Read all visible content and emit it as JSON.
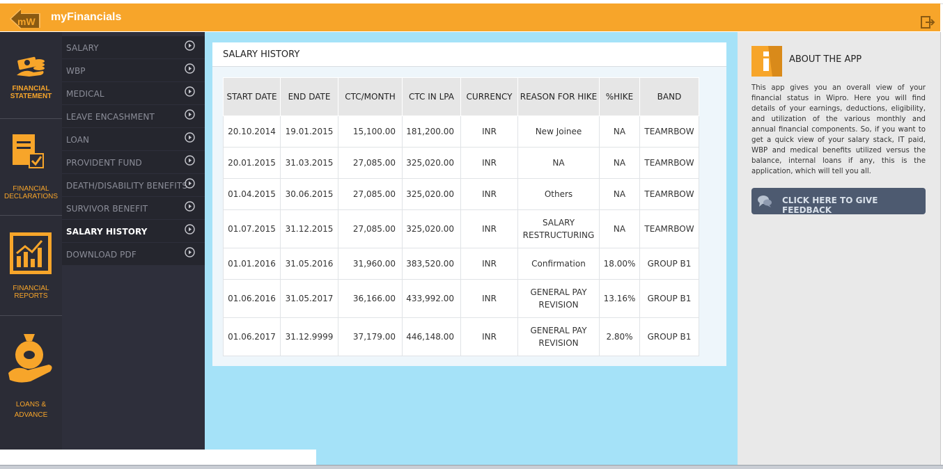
{
  "app": {
    "logo_text": "mW",
    "title": "myFinancials"
  },
  "leftnav": [
    {
      "label": "FINANCIAL STATEMENT",
      "icon": "money-icon"
    },
    {
      "label": "FINANCIAL DECLARATIONS",
      "icon": "declaration-doc-icon"
    },
    {
      "label": "FINANCIAL REPORTS",
      "icon": "report-chart-icon"
    },
    {
      "label": "LOANS & ADVANCE",
      "icon": "money-bag-hand-icon"
    }
  ],
  "submenu": [
    {
      "label": "SALARY"
    },
    {
      "label": "WBP"
    },
    {
      "label": "MEDICAL"
    },
    {
      "label": "LEAVE ENCASHMENT"
    },
    {
      "label": "LOAN"
    },
    {
      "label": "PROVIDENT FUND"
    },
    {
      "label": "DEATH/DISABILITY BENEFITS"
    },
    {
      "label": "SURVIVOR BENEFIT"
    },
    {
      "label": "SALARY HISTORY",
      "active": true
    },
    {
      "label": "DOWNLOAD PDF"
    }
  ],
  "salary_history": {
    "title": "SALARY HISTORY",
    "headers": [
      "START DATE",
      "END DATE",
      "CTC/MONTH",
      "CTC IN LPA",
      "CURRENCY",
      "REASON FOR HIKE",
      "%HIKE",
      "BAND"
    ],
    "rows": [
      [
        "20.10.2014",
        "19.01.2015",
        "15,100.00",
        "181,200.00",
        "INR",
        "New Joinee",
        "NA",
        "TEAMRBOW"
      ],
      [
        "20.01.2015",
        "31.03.2015",
        "27,085.00",
        "325,020.00",
        "INR",
        "NA",
        "NA",
        "TEAMRBOW"
      ],
      [
        "01.04.2015",
        "30.06.2015",
        "27,085.00",
        "325,020.00",
        "INR",
        "Others",
        "NA",
        "TEAMRBOW"
      ],
      [
        "01.07.2015",
        "31.12.2015",
        "27,085.00",
        "325,020.00",
        "INR",
        "SALARY RESTRUCTURING",
        "NA",
        "TEAMRBOW"
      ],
      [
        "01.01.2016",
        "31.05.2016",
        "31,960.00",
        "383,520.00",
        "INR",
        "Confirmation",
        "18.00%",
        "GROUP B1"
      ],
      [
        "01.06.2016",
        "31.05.2017",
        "36,166.00",
        "433,992.00",
        "INR",
        "GENERAL PAY REVISION",
        "13.16%",
        "GROUP B1"
      ],
      [
        "01.06.2017",
        "31.12.9999",
        "37,179.00",
        "446,148.00",
        "INR",
        "GENERAL PAY REVISION",
        "2.80%",
        "GROUP B1"
      ]
    ]
  },
  "about": {
    "title": "ABOUT THE APP",
    "text": "This app gives you an overall view of your financial status in Wipro. Here you will find details of your earnings, deductions, eligibility, and utilization of the various monthly and annual financial components. So, if you want to get a quick view of your salary stack, IT paid, WBP and medical benefits utilized versus the balance, internal loans if any, this is the application, which will tell you all.",
    "feedback_label": "CLICK HERE TO GIVE FEEDBACK"
  },
  "colors": {
    "accent": "#f7a52a",
    "nav_bg": "#2b2c36",
    "main_bg": "#a5e2f8",
    "feedback_bg": "#4d5a70"
  }
}
